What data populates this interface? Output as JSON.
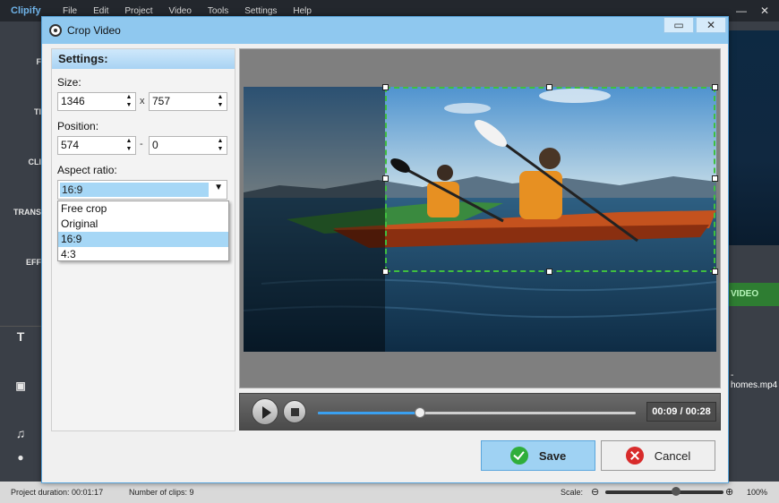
{
  "app": {
    "brand": "Clipify",
    "menu": [
      "File",
      "Edit",
      "Project",
      "Video",
      "Tools",
      "Settings",
      "Help"
    ],
    "side_tools": [
      "F",
      "TI",
      "CLI",
      "TRANS",
      "EFF"
    ],
    "make_video_label": "VIDEO",
    "clip_name": "-homes.mp4",
    "status": {
      "project_duration": "Project duration:  00:01:17",
      "clip_count": "Number of clips: 9",
      "scale_label": "Scale:",
      "zoom_percent": "100%",
      "zoom_level": 0.6
    }
  },
  "dialog": {
    "title": "Crop Video",
    "settings": {
      "header": "Settings:",
      "size_label": "Size:",
      "width": "1346",
      "height": "757",
      "size_sep": "x",
      "position_label": "Position:",
      "pos_x": "574",
      "pos_y": "0",
      "position_sep": "-",
      "aspect_label": "Aspect ratio:",
      "aspect_value": "16:9",
      "aspect_options": [
        "Free crop",
        "Original",
        "16:9",
        "4:3"
      ],
      "aspect_selected_index": 2
    },
    "player": {
      "time": "00:09 / 00:28",
      "progress": 0.32
    },
    "save_label": "Save",
    "cancel_label": "Cancel"
  }
}
